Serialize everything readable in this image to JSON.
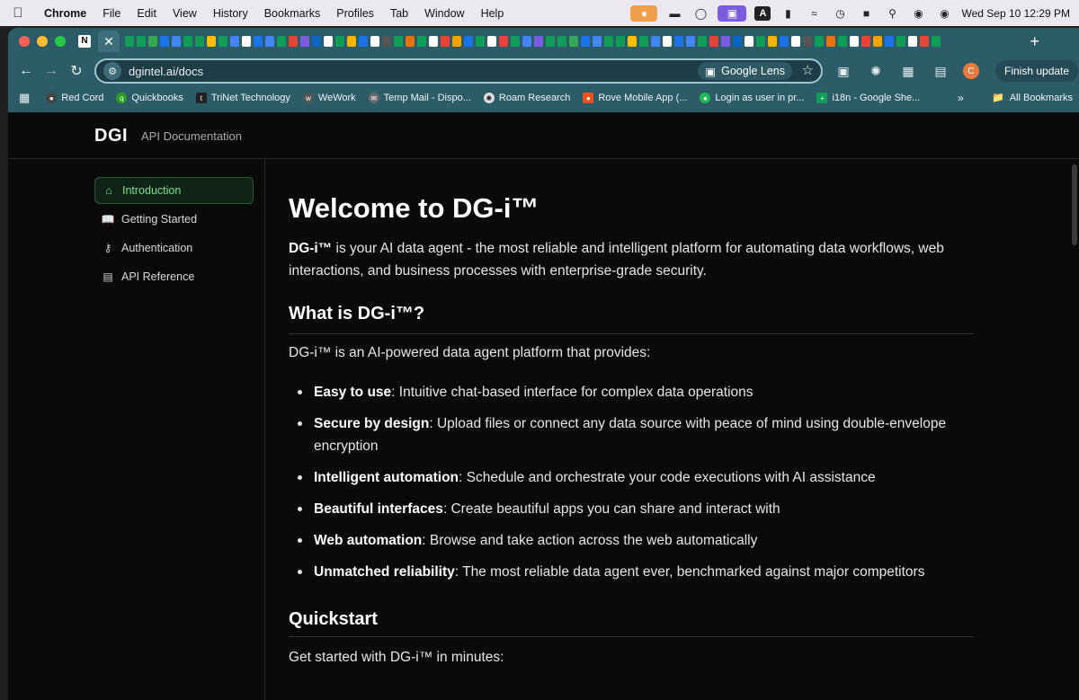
{
  "menubar": {
    "app_name": "Chrome",
    "items": [
      "File",
      "Edit",
      "View",
      "History",
      "Bookmarks",
      "Profiles",
      "Tab",
      "Window",
      "Help"
    ],
    "datetime": "Wed Sep 10  12:29 PM",
    "a_label": "A"
  },
  "browser": {
    "url": "dgintel.ai/docs",
    "lens_label": "Google Lens",
    "finish_update_label": "Finish update",
    "avatar_letter": "C",
    "pinned_tab_letter": "N",
    "bookmarks": [
      "Red Cord",
      "Quickbooks",
      "TriNet Technology",
      "WeWork",
      "Temp Mail - Dispo...",
      "Roam Research",
      "Rove Mobile App (...",
      "Login as user in pr...",
      "i18n - Google She..."
    ],
    "all_bookmarks_label": "All Bookmarks"
  },
  "site": {
    "logo": "DGI",
    "header_title": "API Documentation",
    "sidebar": [
      {
        "label": "Introduction",
        "active": true
      },
      {
        "label": "Getting Started",
        "active": false
      },
      {
        "label": "Authentication",
        "active": false
      },
      {
        "label": "API Reference",
        "active": false
      }
    ]
  },
  "content": {
    "title": "Welcome to DG-i™",
    "lead_bold": "DG-i™",
    "lead_text": " is your AI data agent - the most reliable and intelligent platform for automating data workflows, web interactions, and business processes with enterprise-grade security.",
    "section1_title": "What is DG-i™?",
    "section1_intro": "DG-i™ is an AI-powered data agent platform that provides:",
    "features": [
      {
        "bold": "Easy to use",
        "text": ": Intuitive chat-based interface for complex data operations"
      },
      {
        "bold": "Secure by design",
        "text": ": Upload files or connect any data source with peace of mind using double-envelope encryption"
      },
      {
        "bold": "Intelligent automation",
        "text": ": Schedule and orchestrate your code executions with AI assistance"
      },
      {
        "bold": "Beautiful interfaces",
        "text": ": Create beautiful apps you can share and interact with"
      },
      {
        "bold": "Web automation",
        "text": ": Browse and take action across the web automatically"
      },
      {
        "bold": "Unmatched reliability",
        "text": ": The most reliable data agent ever, benchmarked against major competitors"
      }
    ],
    "section2_title": "Quickstart",
    "section2_intro": "Get started with DG-i™ in minutes:"
  }
}
